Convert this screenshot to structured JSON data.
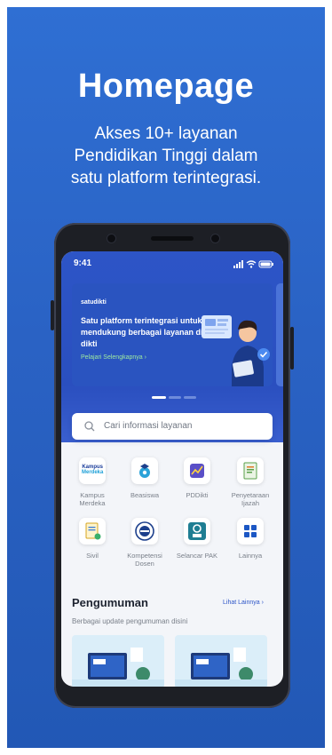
{
  "promo": {
    "headline": "Homepage",
    "subheadline_lines": [
      "Akses 10+ layanan",
      "Pendidikan Tinggi dalam",
      "satu platform terintegrasi."
    ]
  },
  "status_bar": {
    "time": "9:41"
  },
  "banner": {
    "brand": "satudikti",
    "title": "Satu platform terintegrasi untuk mendukung berbagai layanan di dikti",
    "link_label": "Pelajari Selengkapnya",
    "page_index": 1,
    "page_count": 3
  },
  "search": {
    "placeholder": "Cari informasi layanan"
  },
  "services": [
    {
      "label": "Kampus Merdeka",
      "icon": "kampus-merdeka-logo"
    },
    {
      "label": "Beasiswa",
      "icon": "beasiswa-icon"
    },
    {
      "label": "PDDikti",
      "icon": "pddikti-icon"
    },
    {
      "label": "Penyetaraan Ijazah",
      "icon": "ijazah-icon"
    },
    {
      "label": "Sivil",
      "icon": "sivil-icon"
    },
    {
      "label": "Kompetensi Dosen",
      "icon": "serdos-icon"
    },
    {
      "label": "Selancar PAK",
      "icon": "pak-icon"
    },
    {
      "label": "Lainnya",
      "icon": "grid-icon"
    }
  ],
  "announcements": {
    "title": "Pengumuman",
    "more_label": "Lihat Lainnya",
    "subtitle": "Berbagai update pengumuman disini"
  },
  "colors": {
    "background": "#2a62c4",
    "hero": "#2d55c7",
    "accent_green": "#9ce7a1",
    "link": "#2d55c7"
  }
}
